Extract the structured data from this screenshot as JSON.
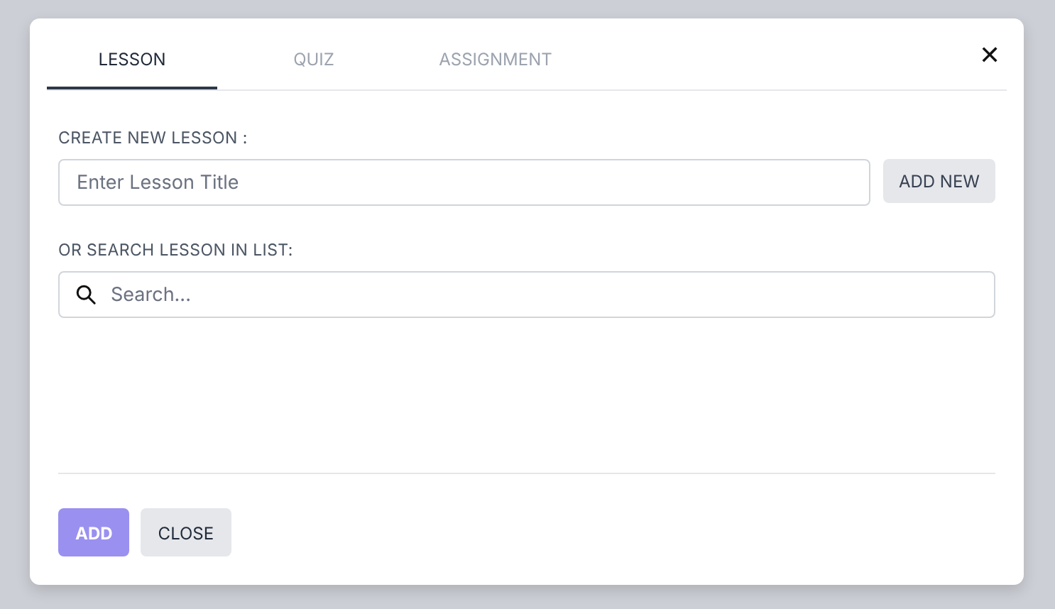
{
  "tabs": [
    {
      "label": "LESSON",
      "selected": true
    },
    {
      "label": "QUIZ",
      "selected": false
    },
    {
      "label": "ASSIGNMENT",
      "selected": false
    }
  ],
  "close_icon": "✕",
  "create": {
    "label": "CREATE NEW LESSON :",
    "placeholder": "Enter Lesson Title",
    "button": "ADD NEW"
  },
  "search": {
    "label": "OR SEARCH LESSON IN LIST:",
    "placeholder": "Search..."
  },
  "buttons": [
    {
      "label": "ADD",
      "kind": "primary"
    },
    {
      "label": "CLOSE",
      "kind": "secondary"
    }
  ]
}
